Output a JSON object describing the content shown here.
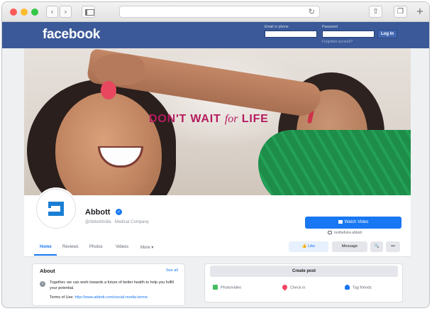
{
  "browser": {
    "back_icon": "chevron-left",
    "forward_icon": "chevron-right",
    "reload_icon": "reload",
    "share_icon": "share",
    "tabs_icon": "tabs",
    "new_tab_icon": "plus"
  },
  "fb_header": {
    "logo": "facebook",
    "email_label": "Email or phone",
    "password_label": "Password",
    "login_button": "Log In",
    "forgot_link": "Forgotten account?",
    "bar_color": "#3b5998"
  },
  "cover": {
    "headline_main": "DON'T WAIT ",
    "headline_for": "for",
    "headline_end": " LIFE",
    "headline_color": "#b31b5e"
  },
  "profile": {
    "name": "Abbott",
    "verified_mark": "✓",
    "handle": "@AbbottIndia · Medical Company",
    "watch_video": "Watch Video",
    "website": "mothefutre.abbott"
  },
  "tabs": [
    {
      "label": "Home",
      "active": true
    },
    {
      "label": "Reviews"
    },
    {
      "label": "Photos"
    },
    {
      "label": "Videos"
    },
    {
      "label": "More ▾"
    }
  ],
  "actions": {
    "like": "👍 Like",
    "message": "Message",
    "search_icon": "🔍",
    "more_icon": "•••"
  },
  "about": {
    "title": "About",
    "see_all": "See all",
    "description": "Together, we can work towards a future of better health to help you fulfill your potential.",
    "terms_label": "Terms of Use: ",
    "terms_url": "http://www.abbott.com/social-media-terms-"
  },
  "post": {
    "create": "Create post",
    "photo_video": "Photo/video",
    "check_in": "Check in",
    "tag_friends": "Tag friends"
  },
  "colors": {
    "accent": "#1877f2",
    "abbott_blue": "#1a7fd4"
  }
}
